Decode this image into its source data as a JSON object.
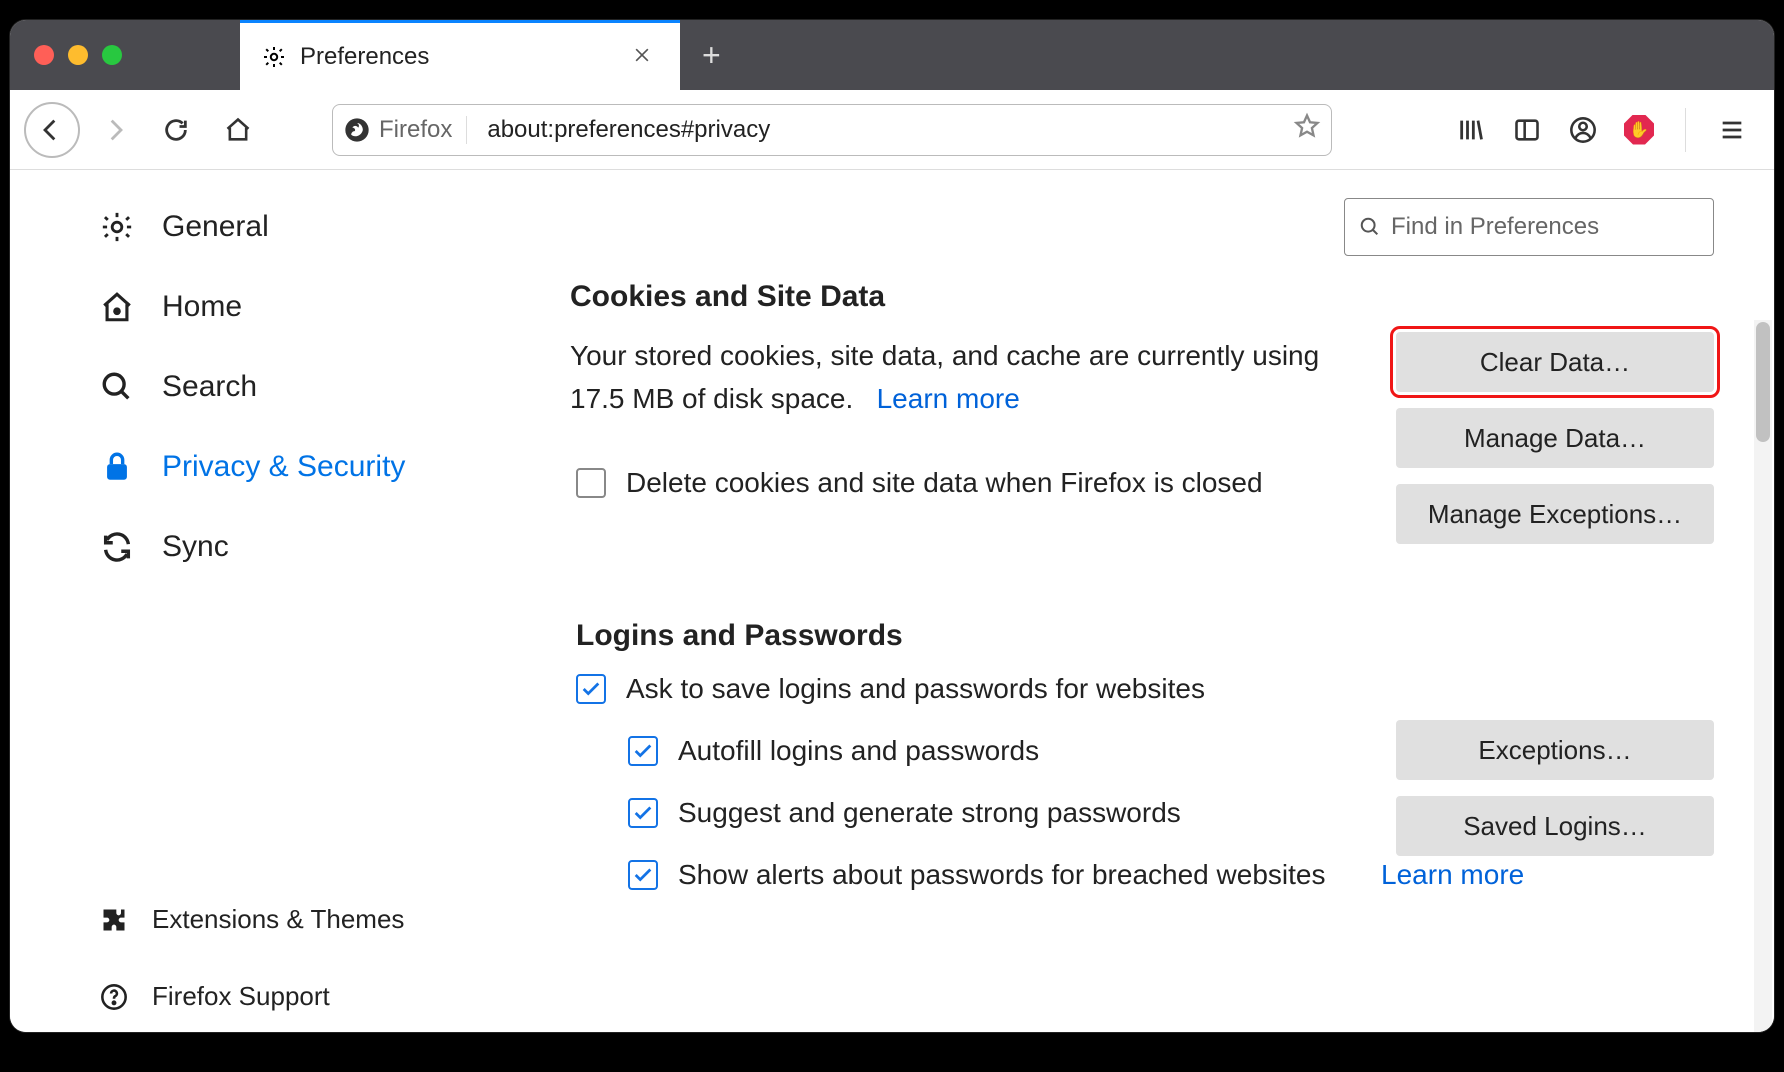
{
  "tab": {
    "title": "Preferences"
  },
  "urlbar": {
    "brand": "Firefox",
    "address": "about:preferences#privacy"
  },
  "sidebar": {
    "general": "General",
    "home": "Home",
    "search": "Search",
    "privacy": "Privacy & Security",
    "sync": "Sync",
    "extensions": "Extensions & Themes",
    "support": "Firefox Support"
  },
  "search_placeholder": "Find in Preferences",
  "cookies": {
    "heading": "Cookies and Site Data",
    "desc": "Your stored cookies, site data, and cache are currently using 17.5 MB of disk space.",
    "learn_more": "Learn more",
    "delete_on_close": "Delete cookies and site data when Firefox is closed",
    "btn_clear": "Clear Data…",
    "btn_manage": "Manage Data…",
    "btn_exceptions": "Manage Exceptions…"
  },
  "logins": {
    "heading": "Logins and Passwords",
    "ask_save": "Ask to save logins and passwords for websites",
    "autofill": "Autofill logins and passwords",
    "suggest": "Suggest and generate strong passwords",
    "breached": "Show alerts about passwords for breached websites",
    "learn_more": "Learn more",
    "btn_exceptions": "Exceptions…",
    "btn_saved": "Saved Logins…"
  }
}
